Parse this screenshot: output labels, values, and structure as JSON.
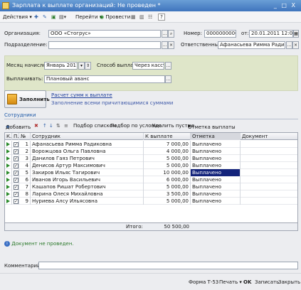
{
  "window": {
    "title": "Зарплата к выплате организаций: Не проведен *",
    "controls": "_ □ X"
  },
  "toolbar": {
    "actions": "Действия",
    "go": "Перейти",
    "post": "Провести"
  },
  "form": {
    "org_label": "Организация:",
    "org_value": "ООО «Стогрус»",
    "num_label": "Номер:",
    "num_value": "00000000001",
    "date_label": "от:",
    "date_value": "20.01.2011 12:00:00",
    "dept_label": "Подразделение:",
    "dept_value": "",
    "resp_label": "Ответственный:",
    "resp_value": "Афанасьева Римма Радиковна",
    "month_label": "Месяц начисления:",
    "month_value": "Январь 2011",
    "method_label": "Способ выплаты:",
    "method_value": "Через кассу",
    "pay_label": "Выплачивать:",
    "pay_value": "Плановый аванс"
  },
  "fill": {
    "button": "Заполнить",
    "link1": "Расчет сумм к выплате",
    "link2": "Заполнение всеми причитающимися суммами"
  },
  "section": {
    "title": "Сотрудники"
  },
  "table_toolbar": {
    "add": "Добавить",
    "pick_list": "Подбор списком",
    "pick_cond": "Подбор по условию",
    "delete_empty": "Удалить пустые",
    "mark": "Отметка выплаты"
  },
  "table": {
    "headers": {
      "k": "К...",
      "p": "П...",
      "n": "№",
      "emp": "Сотрудник",
      "pay": "К выплате",
      "mark": "Отметка",
      "doc": "Документ"
    },
    "rows": [
      {
        "n": "1",
        "emp": "Афанасьева Римма Радиковна",
        "pay": "7 000,00",
        "mark": "Выплачено"
      },
      {
        "n": "2",
        "emp": "Ворожцова Ольга Павловна",
        "pay": "4 000,00",
        "mark": "Выплачено"
      },
      {
        "n": "3",
        "emp": "Данилов Гаяз Петрович",
        "pay": "5 000,00",
        "mark": "Выплачено"
      },
      {
        "n": "4",
        "emp": "Денисов Артур Максимович",
        "pay": "5 000,00",
        "mark": "Выплачено"
      },
      {
        "n": "5",
        "emp": "Закиров Ильяс Тагирович",
        "pay": "10 000,00",
        "mark": "Выплачено"
      },
      {
        "n": "6",
        "emp": "Иванов Игорь Васильевич",
        "pay": "6 000,00",
        "mark": "Выплачено"
      },
      {
        "n": "7",
        "emp": "Кашапов Ришат Робертович",
        "pay": "5 000,00",
        "mark": "Выплачено"
      },
      {
        "n": "8",
        "emp": "Ларина Олеся Михайловна",
        "pay": "3 500,00",
        "mark": "Выплачено"
      },
      {
        "n": "9",
        "emp": "Нуриева Алсу Ильясовна",
        "pay": "5 000,00",
        "mark": "Выплачено"
      }
    ],
    "total_label": "Итого:",
    "total_value": "50 500,00"
  },
  "info": {
    "text": "Документ не проведен."
  },
  "comment": {
    "label": "Комментарий:",
    "value": ""
  },
  "bottom": {
    "form": "Форма Т-53",
    "print": "Печать",
    "ok": "OK",
    "save": "Записать",
    "close": "Закрыть"
  }
}
